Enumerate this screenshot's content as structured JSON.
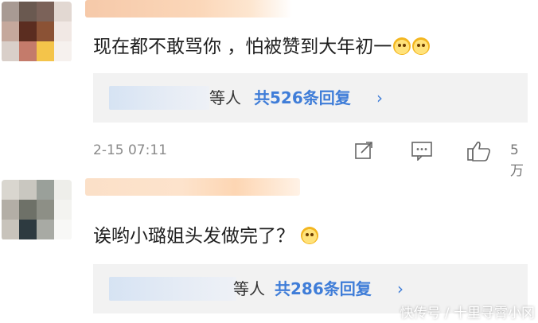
{
  "comments": [
    {
      "text": "现在都不敢骂你 ，怕被赞到大年初一",
      "emoji_count": 2,
      "reply_suffix": "等人",
      "reply_count_label": "共526条回复",
      "timestamp": "2-15 07:11",
      "like_count": "5万",
      "icons": [
        "share-icon",
        "comment-icon",
        "thumb-up-icon",
        "laughing-cat-emoji"
      ]
    },
    {
      "text": "诶哟小璐姐头发做完了？",
      "emoji_count": 1,
      "reply_suffix": "等人",
      "reply_count_label": "共286条回复",
      "icons": [
        "laughing-cat-emoji"
      ]
    }
  ],
  "watermark": "快传号 / 十里寻霄小冈",
  "colors": {
    "link": "#3f7dd8",
    "reply_bg": "#f2f2f2",
    "meta": "#8a8a8a"
  }
}
